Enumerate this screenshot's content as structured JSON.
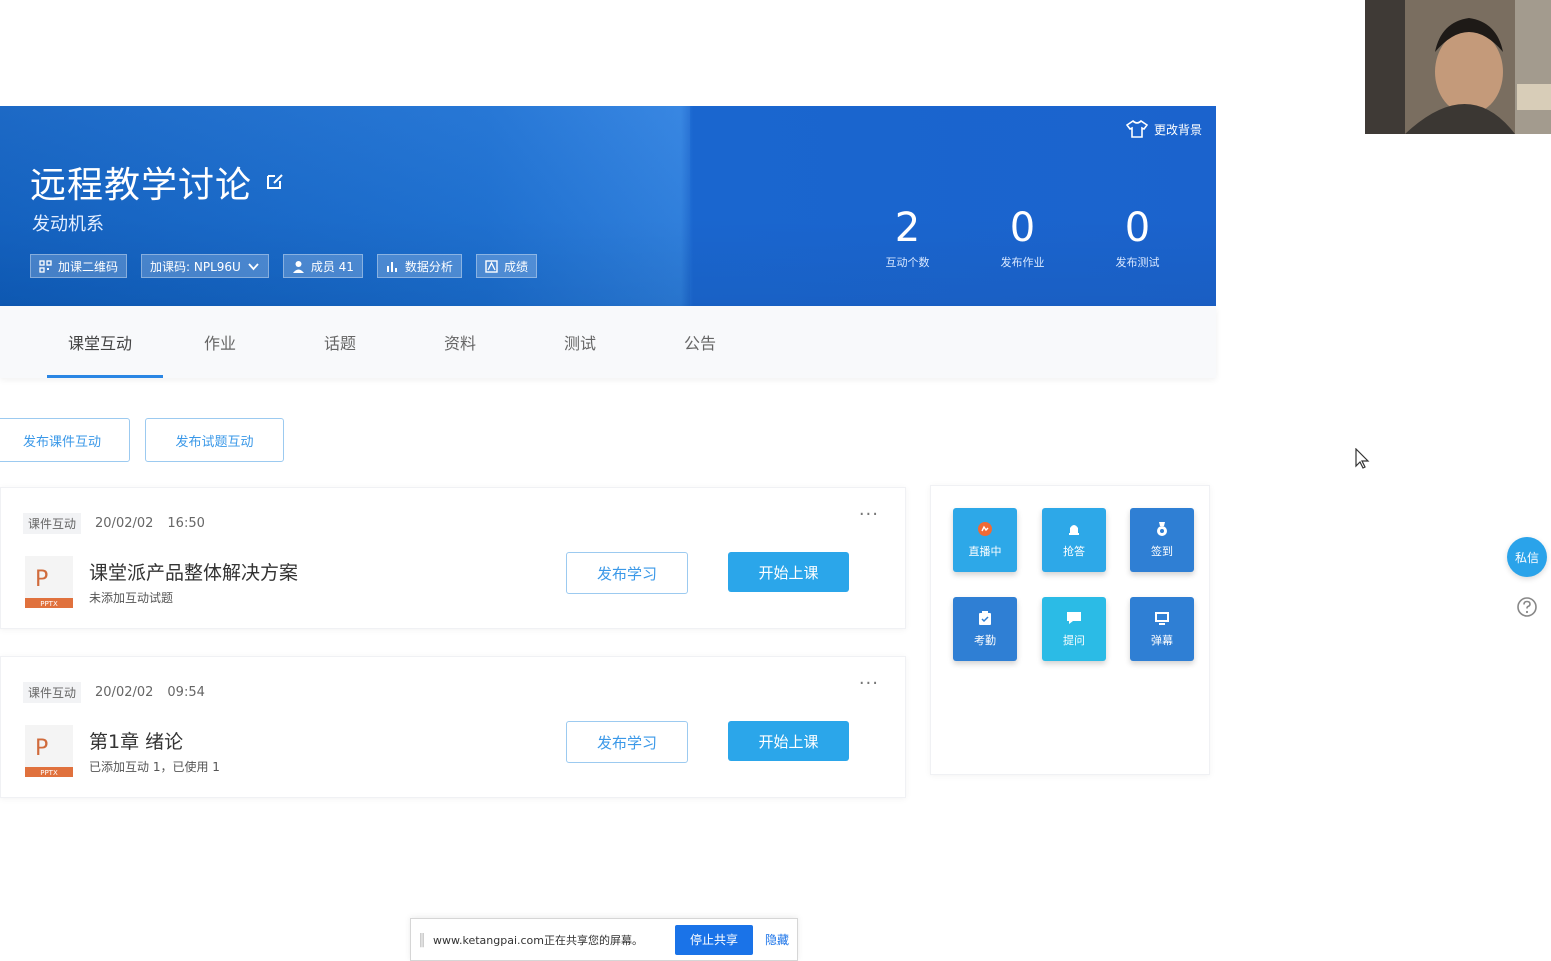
{
  "course": {
    "title": "远程教学讨论",
    "subtitle": "发动机系",
    "chips": [
      {
        "label": "加课二维码",
        "icon": "qrcode-icon"
      },
      {
        "label": "加课码: NPL96U",
        "icon": "chevron-down-icon"
      },
      {
        "label": "成员 41",
        "icon": "user-icon"
      },
      {
        "label": "数据分析",
        "icon": "bar-chart-icon"
      },
      {
        "label": "成绩",
        "icon": "grade-icon"
      }
    ],
    "change_background": "更改背景",
    "stats": [
      {
        "value": "2",
        "label": "互动个数"
      },
      {
        "value": "0",
        "label": "发布作业"
      },
      {
        "value": "0",
        "label": "发布测试"
      }
    ]
  },
  "tabs": [
    {
      "label": "课堂互动",
      "active": true
    },
    {
      "label": "作业"
    },
    {
      "label": "话题"
    },
    {
      "label": "资料"
    },
    {
      "label": "测试"
    },
    {
      "label": "公告"
    }
  ],
  "publish": {
    "courseware_label": "发布课件互动",
    "quiz_label": "发布试题互动"
  },
  "cards": [
    {
      "tag": "课件互动",
      "date": "20/02/02",
      "time": "16:50",
      "title": "课堂派产品整体解决方案",
      "desc": "未添加互动试题",
      "file_type": "PPTX",
      "learn_label": "发布学习",
      "start_label": "开始上课"
    },
    {
      "tag": "课件互动",
      "date": "20/02/02",
      "time": "09:54",
      "title": "第1章 绪论",
      "desc": "已添加互动 1，已使用 1",
      "file_type": "PPTX",
      "learn_label": "发布学习",
      "start_label": "开始上课"
    }
  ],
  "tools": [
    {
      "label": "直播中",
      "icon": "live-icon",
      "color": "#2da8e8"
    },
    {
      "label": "抢答",
      "icon": "bell-icon",
      "color": "#2da8e8"
    },
    {
      "label": "签到",
      "icon": "medal-icon",
      "color": "#2f7fd4"
    },
    {
      "label": "考勤",
      "icon": "clipboard-icon",
      "color": "#2f7fd4"
    },
    {
      "label": "提问",
      "icon": "chat-icon",
      "color": "#2bbbe6"
    },
    {
      "label": "弹幕",
      "icon": "screen-icon",
      "color": "#2f7fd4"
    }
  ],
  "side": {
    "message_label": "私信"
  },
  "share_bar": {
    "text": "www.ketangpai.com正在共享您的屏幕。",
    "stop_label": "停止共享",
    "hide_label": "隐藏"
  },
  "colors": {
    "banner": "#1a6fd3",
    "accent": "#2ba6ea",
    "tab_indicator": "#2b86e4"
  }
}
